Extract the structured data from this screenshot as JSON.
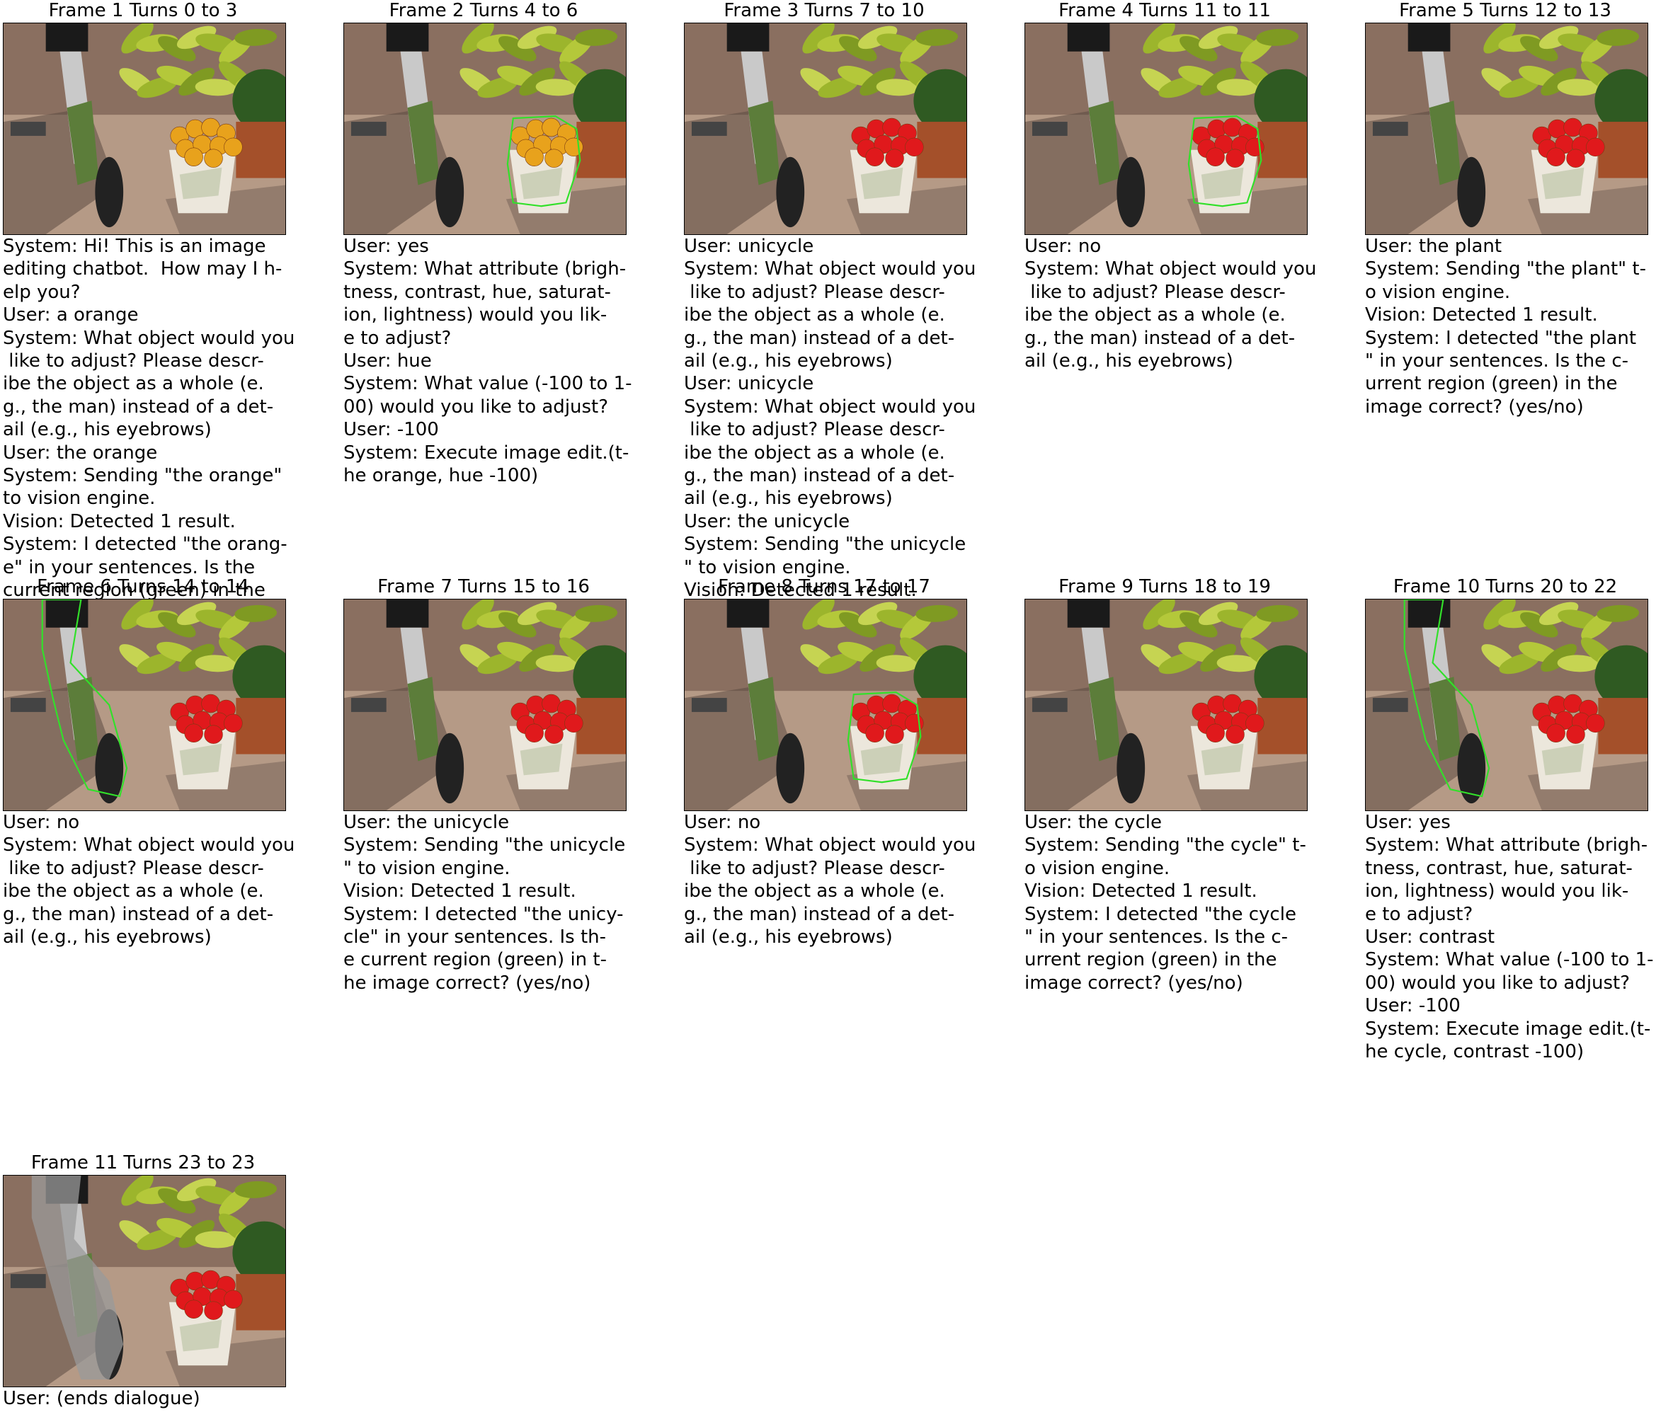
{
  "frames": [
    {
      "title": "Frame 1 Turns 0 to 3",
      "fruit_color": "#e8a21c",
      "outline": "none",
      "gray_overlay": false,
      "lines": [
        "System: Hi! This is an image",
        "editing chatbot.  How may I h-",
        "elp you?",
        "User: a orange",
        "System: What object would you",
        " like to adjust? Please descr-",
        "ibe the object as a whole (e.",
        "g., the man) instead of a det-",
        "ail (e.g., his eyebrows)",
        "User: the orange",
        "System: Sending \"the orange\"",
        "to vision engine.",
        "Vision: Detected 1 result.",
        "System: I detected \"the orang-",
        "e\" in your sentences. Is the",
        "current region (green) in the"
      ]
    },
    {
      "title": "Frame 2 Turns 4 to 6",
      "fruit_color": "#e8a21c",
      "outline": "bucket",
      "gray_overlay": false,
      "lines": [
        "User: yes",
        "System: What attribute (brigh-",
        "tness, contrast, hue, saturat-",
        "ion, lightness) would you lik-",
        "e to adjust?",
        "User: hue",
        "System: What value (-100 to 1-",
        "00) would you like to adjust?",
        "User: -100",
        "System: Execute image edit.(t-",
        "he orange, hue -100)"
      ]
    },
    {
      "title": "Frame 3 Turns 7 to 10",
      "fruit_color": "#e0191c",
      "outline": "none",
      "gray_overlay": false,
      "lines": [
        "User: unicycle",
        "System: What object would you",
        " like to adjust? Please descr-",
        "ibe the object as a whole (e.",
        "g., the man) instead of a det-",
        "ail (e.g., his eyebrows)",
        "User: unicycle",
        "System: What object would you",
        " like to adjust? Please descr-",
        "ibe the object as a whole (e.",
        "g., the man) instead of a det-",
        "ail (e.g., his eyebrows)",
        "User: the unicycle",
        "System: Sending \"the unicycle",
        "\" to vision engine.",
        "Vision: Detected 1 result."
      ]
    },
    {
      "title": "Frame 4 Turns 11 to 11",
      "fruit_color": "#e0191c",
      "outline": "bucket",
      "gray_overlay": false,
      "lines": [
        "User: no",
        "System: What object would you",
        " like to adjust? Please descr-",
        "ibe the object as a whole (e.",
        "g., the man) instead of a det-",
        "ail (e.g., his eyebrows)"
      ]
    },
    {
      "title": "Frame 5 Turns 12 to 13",
      "fruit_color": "#e0191c",
      "outline": "none",
      "gray_overlay": false,
      "lines": [
        "User: the plant",
        "System: Sending \"the plant\" t-",
        "o vision engine.",
        "Vision: Detected 1 result.",
        "System: I detected \"the plant",
        "\" in your sentences. Is the c-",
        "urrent region (green) in the",
        "image correct? (yes/no)"
      ]
    },
    {
      "title": "Frame 6 Turns 14 to 14",
      "fruit_color": "#e0191c",
      "outline": "cycle",
      "gray_overlay": false,
      "lines": [
        "User: no",
        "System: What object would you",
        " like to adjust? Please descr-",
        "ibe the object as a whole (e.",
        "g., the man) instead of a det-",
        "ail (e.g., his eyebrows)"
      ]
    },
    {
      "title": "Frame 7 Turns 15 to 16",
      "fruit_color": "#e0191c",
      "outline": "none",
      "gray_overlay": false,
      "lines": [
        "User: the unicycle",
        "System: Sending \"the unicycle",
        "\" to vision engine.",
        "Vision: Detected 1 result.",
        "System: I detected \"the unicy-",
        "cle\" in your sentences. Is th-",
        "e current region (green) in t-",
        "he image correct? (yes/no)"
      ]
    },
    {
      "title": "Frame 8 Turns 17 to 17",
      "fruit_color": "#e0191c",
      "outline": "bucket",
      "gray_overlay": false,
      "lines": [
        "User: no",
        "System: What object would you",
        " like to adjust? Please descr-",
        "ibe the object as a whole (e.",
        "g., the man) instead of a det-",
        "ail (e.g., his eyebrows)"
      ]
    },
    {
      "title": "Frame 9 Turns 18 to 19",
      "fruit_color": "#e0191c",
      "outline": "none",
      "gray_overlay": false,
      "lines": [
        "User: the cycle",
        "System: Sending \"the cycle\" t-",
        "o vision engine.",
        "Vision: Detected 1 result.",
        "System: I detected \"the cycle",
        "\" in your sentences. Is the c-",
        "urrent region (green) in the",
        "image correct? (yes/no)"
      ]
    },
    {
      "title": "Frame 10 Turns 20 to 22",
      "fruit_color": "#e0191c",
      "outline": "cycle",
      "gray_overlay": false,
      "lines": [
        "User: yes",
        "System: What attribute (brigh-",
        "tness, contrast, hue, saturat-",
        "ion, lightness) would you lik-",
        "e to adjust?",
        "User: contrast",
        "System: What value (-100 to 1-",
        "00) would you like to adjust?",
        "User: -100",
        "System: Execute image edit.(t-",
        "he cycle, contrast -100)"
      ]
    },
    {
      "title": "Frame 11 Turns 23 to 23",
      "fruit_color": "#e0191c",
      "outline": "none",
      "gray_overlay": true,
      "lines": [
        "User: (ends dialogue)"
      ]
    }
  ]
}
